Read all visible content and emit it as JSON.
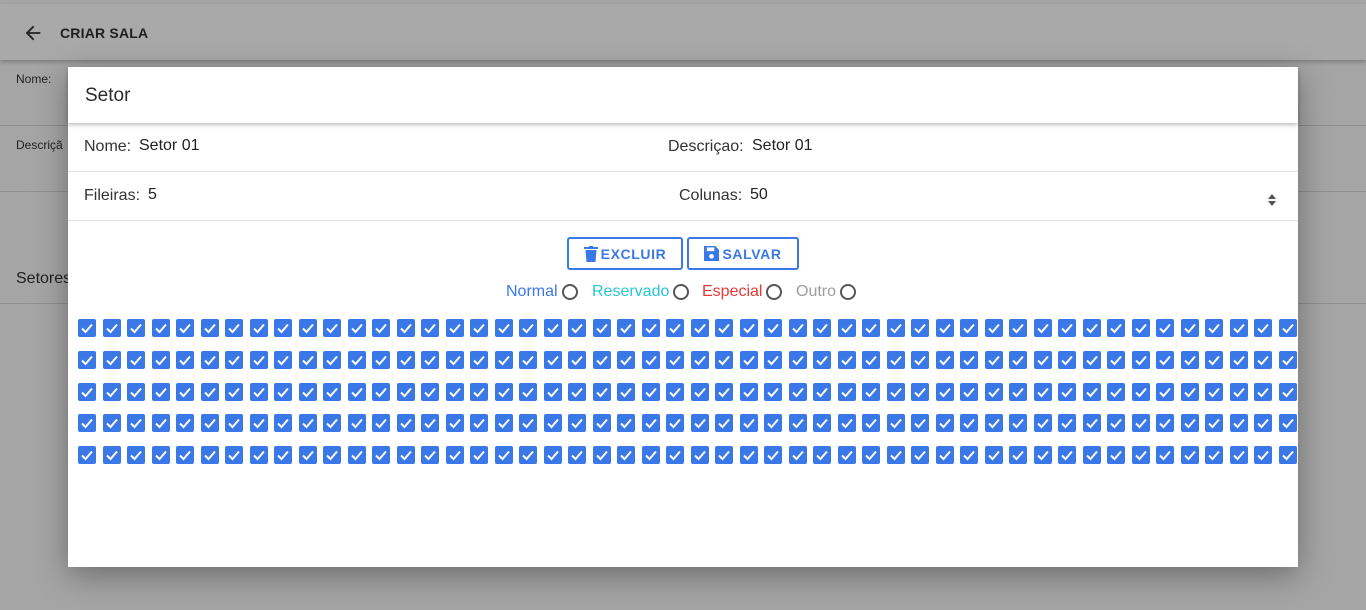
{
  "appbar": {
    "title": "CRIAR SALA",
    "back_icon": "arrow-left-icon"
  },
  "background_form": {
    "nome_label": "Nome:",
    "descricao_label": "Descriçã",
    "setores_label": "Setores"
  },
  "dialog": {
    "title": "Setor",
    "nome": {
      "label": "Nome:",
      "value": "Setor 01"
    },
    "descricao": {
      "label": "Descriçao:",
      "value": "Setor 01"
    },
    "fileiras": {
      "label": "Fileiras:",
      "value": "5"
    },
    "colunas": {
      "label": "Colunas:",
      "value": "50"
    },
    "buttons": {
      "excluir": "EXCLUIR",
      "salvar": "SALVAR"
    },
    "seat_types": [
      {
        "label": "Normal",
        "color": "#3b78e7"
      },
      {
        "label": "Reservado",
        "color": "#26c6da"
      },
      {
        "label": "Especial",
        "color": "#e53935"
      },
      {
        "label": "Outro",
        "color": "#9e9e9e"
      }
    ],
    "seat_grid": {
      "rows": 5,
      "cols": 50,
      "checked": true,
      "checkbox_color": "#3b78e7"
    }
  },
  "colors": {
    "accent": "#3b78e7"
  }
}
